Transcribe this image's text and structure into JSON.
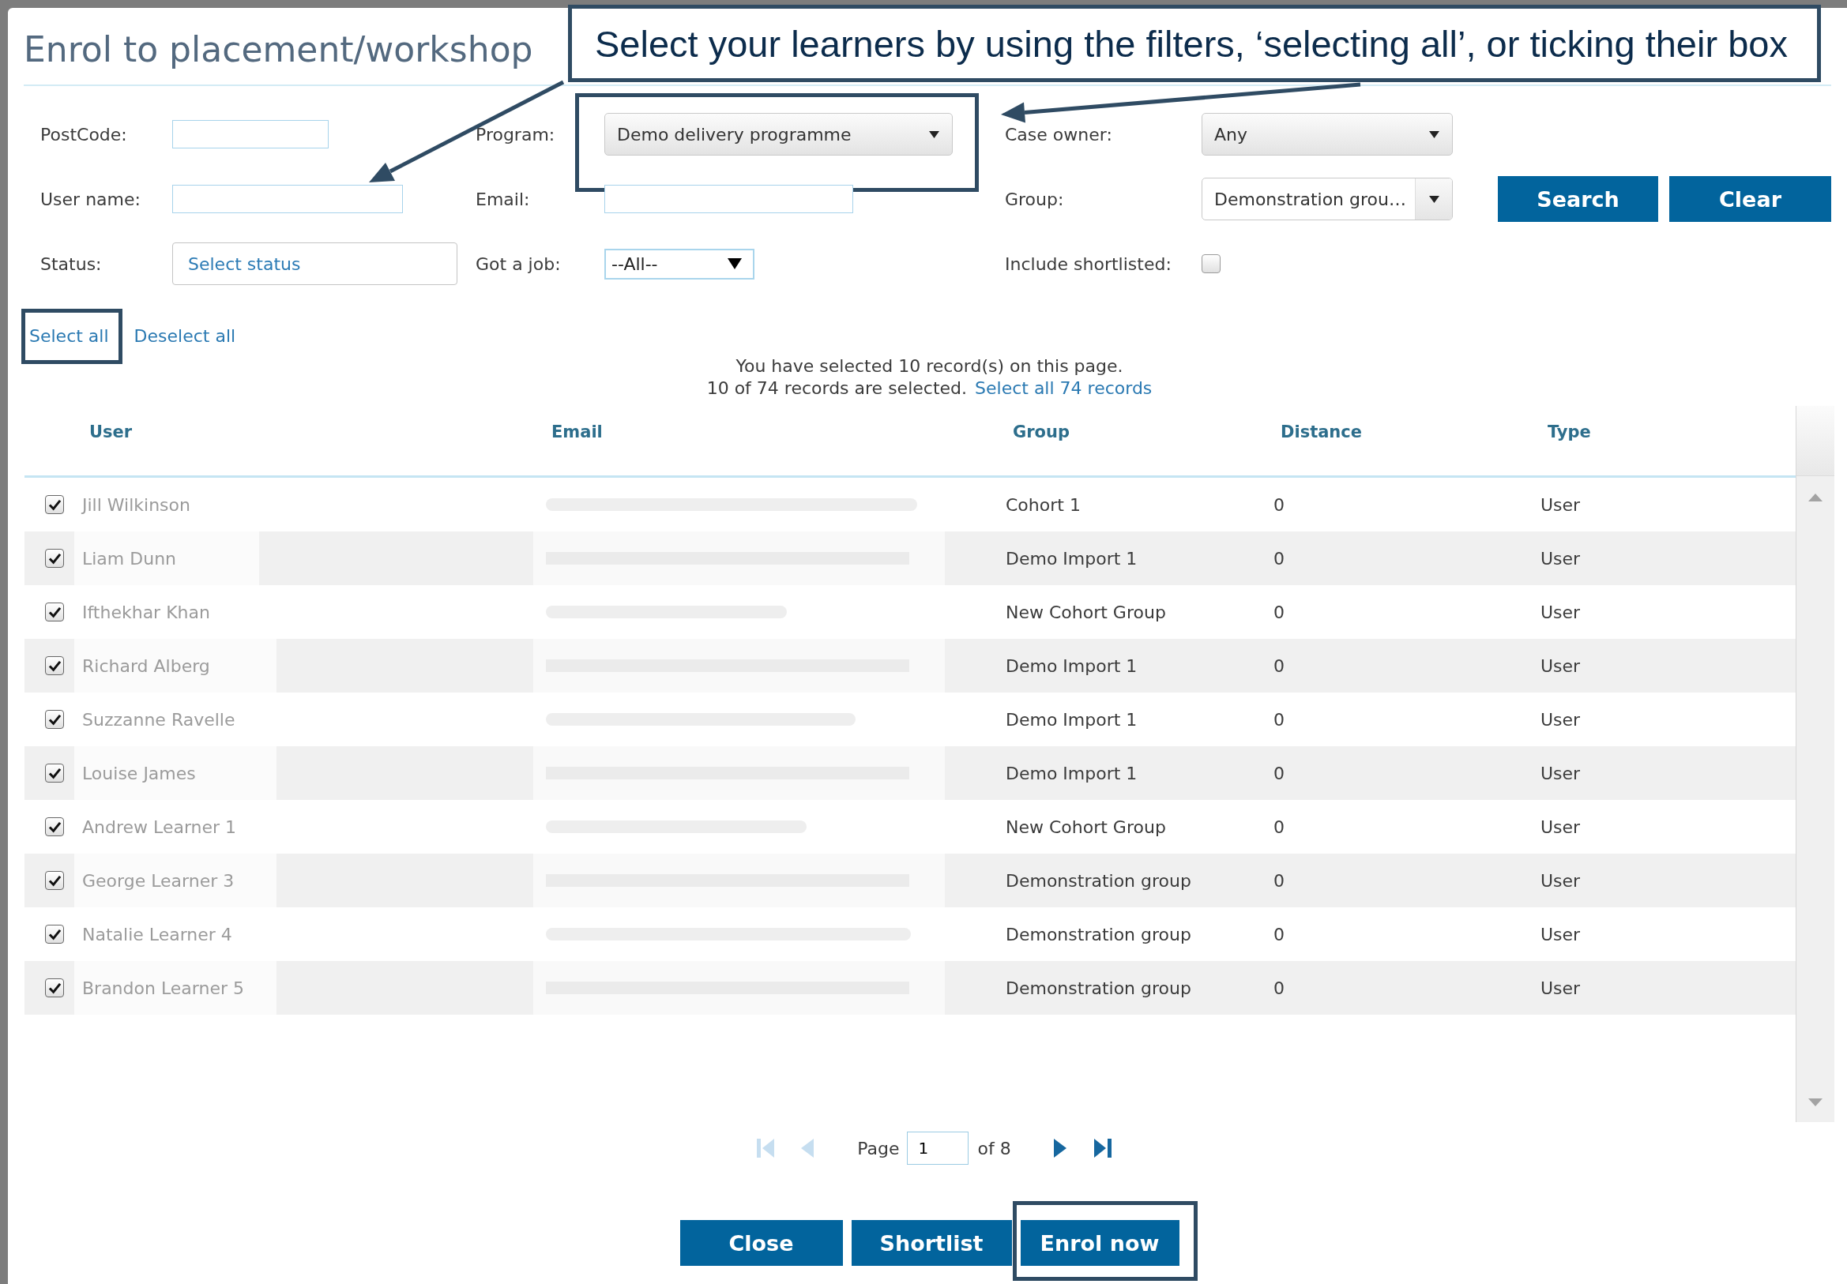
{
  "dialog": {
    "title": "Enrol to placement/workshop"
  },
  "callout": "Select your learners by using the filters, ‘selecting all’, or ticking their box",
  "filters": [
    {
      "label": "PostCode:",
      "kind": "text",
      "highlighted": false
    },
    {
      "label": "Program:",
      "kind": "dropdown",
      "value": "Demo delivery programme",
      "highlighted": true
    },
    {
      "label": "Case owner:",
      "kind": "dropdown",
      "value": "Any",
      "highlighted": false
    },
    {
      "label": "User name:",
      "kind": "text",
      "highlighted": false
    },
    {
      "label": "Email:",
      "kind": "text",
      "highlighted": false
    },
    {
      "label": "Group:",
      "kind": "combobox",
      "value": "Demonstration grou…",
      "highlighted": false
    },
    {
      "label": "Status:",
      "kind": "picker",
      "placeholder": "Select status",
      "highlighted": false
    },
    {
      "label": "Got a job:",
      "kind": "select",
      "value": "--All--",
      "highlighted": false
    },
    {
      "label": "Include shortlisted:",
      "kind": "checkbox",
      "checked": false,
      "highlighted": false
    }
  ],
  "search_buttons": [
    "Search",
    "Clear"
  ],
  "selection_links": [
    {
      "label": "Select all",
      "highlighted": true
    },
    {
      "label": "Deselect all",
      "highlighted": false
    }
  ],
  "selection_summary": {
    "line_1": "You have selected 10 record(s) on this page.",
    "line_2": "10 of 74 records are selected.",
    "link": "Select all 74 records"
  },
  "table": {
    "columns": [
      "User",
      "Email",
      "Group",
      "Distance",
      "Type"
    ],
    "rows": [
      {
        "checked": true,
        "user": "Jill Wilkinson",
        "group": "Cohort 1",
        "distance": "0",
        "type": "User"
      },
      {
        "checked": true,
        "user": "Liam Dunn",
        "group": "Demo Import 1",
        "distance": "0",
        "type": "User"
      },
      {
        "checked": true,
        "user": "Ifthekhar Khan",
        "group": "New Cohort Group",
        "distance": "0",
        "type": "User"
      },
      {
        "checked": true,
        "user": "Richard Alberg",
        "group": "Demo Import 1",
        "distance": "0",
        "type": "User"
      },
      {
        "checked": true,
        "user": "Suzzanne Ravelle",
        "group": "Demo Import 1",
        "distance": "0",
        "type": "User"
      },
      {
        "checked": true,
        "user": "Louise James",
        "group": "Demo Import 1",
        "distance": "0",
        "type": "User"
      },
      {
        "checked": true,
        "user": "Andrew Learner 1",
        "group": "New Cohort Group",
        "distance": "0",
        "type": "User"
      },
      {
        "checked": true,
        "user": "George Learner 3",
        "group": "Demonstration group",
        "distance": "0",
        "type": "User"
      },
      {
        "checked": true,
        "user": "Natalie Learner 4",
        "group": "Demonstration group",
        "distance": "0",
        "type": "User"
      },
      {
        "checked": true,
        "user": "Brandon Learner 5",
        "group": "Demonstration group",
        "distance": "0",
        "type": "User"
      }
    ]
  },
  "pagination": {
    "back": [
      {
        "kind": "first",
        "disabled": true
      },
      {
        "kind": "previous",
        "disabled": true
      }
    ],
    "page_label": "Page",
    "page": "1",
    "page_count": "of 8",
    "forward": [
      {
        "kind": "next",
        "disabled": false
      },
      {
        "kind": "last",
        "disabled": false
      }
    ]
  },
  "footer_buttons": [
    {
      "label": "Close",
      "highlighted": false
    },
    {
      "label": "Shortlist",
      "highlighted": false
    },
    {
      "label": "Enrol now",
      "highlighted": true
    }
  ]
}
